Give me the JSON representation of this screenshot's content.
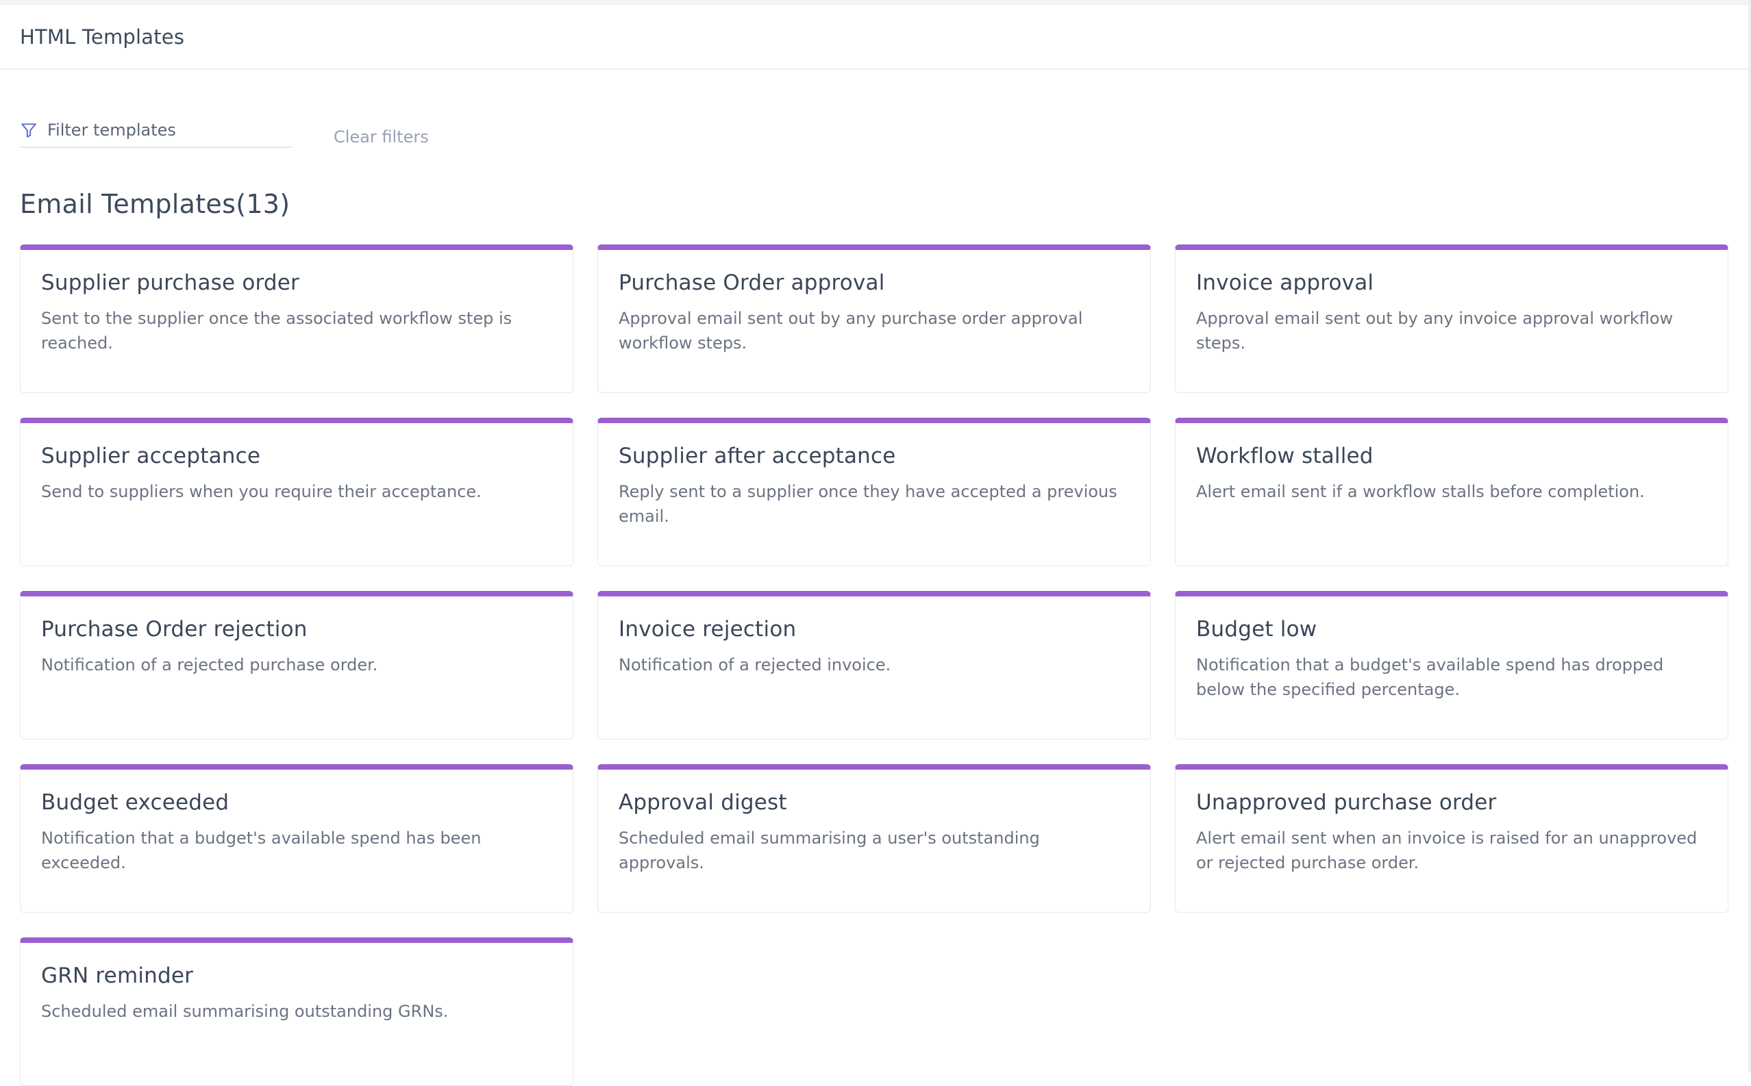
{
  "header": {
    "title": "HTML Templates"
  },
  "filter": {
    "placeholder": "Filter templates",
    "clear_label": "Clear filters"
  },
  "section": {
    "title": "Email Templates(13)"
  },
  "colors": {
    "accent": "#9b5fd1",
    "filter_icon": "#5b6bd6"
  },
  "templates": [
    {
      "title": "Supplier purchase order",
      "description": "Sent to the supplier once the associated workflow step is reached."
    },
    {
      "title": "Purchase Order approval",
      "description": "Approval email sent out by any purchase order approval workflow steps."
    },
    {
      "title": "Invoice approval",
      "description": "Approval email sent out by any invoice approval workflow steps."
    },
    {
      "title": "Supplier acceptance",
      "description": "Send to suppliers when you require their acceptance."
    },
    {
      "title": "Supplier after acceptance",
      "description": "Reply sent to a supplier once they have accepted a previous email."
    },
    {
      "title": "Workflow stalled",
      "description": "Alert email sent if a workflow stalls before completion."
    },
    {
      "title": "Purchase Order rejection",
      "description": "Notification of a rejected purchase order."
    },
    {
      "title": "Invoice rejection",
      "description": "Notification of a rejected invoice."
    },
    {
      "title": "Budget low",
      "description": "Notification that a budget's available spend has dropped below the specified percentage."
    },
    {
      "title": "Budget exceeded",
      "description": "Notification that a budget's available spend has been exceeded."
    },
    {
      "title": "Approval digest",
      "description": "Scheduled email summarising a user's outstanding approvals."
    },
    {
      "title": "Unapproved purchase order",
      "description": "Alert email sent when an invoice is raised for an unapproved or rejected purchase order."
    },
    {
      "title": "GRN reminder",
      "description": "Scheduled email summarising outstanding GRNs."
    }
  ]
}
